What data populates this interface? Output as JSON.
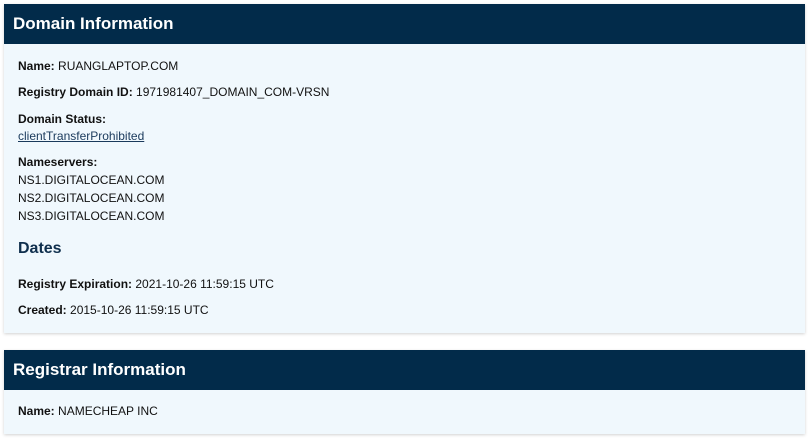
{
  "domain_info": {
    "title": "Domain Information",
    "name_label": "Name:",
    "name_value": "RUANGLAPTOP.COM",
    "registry_id_label": "Registry Domain ID:",
    "registry_id_value": "1971981407_DOMAIN_COM-VRSN",
    "status_label": "Domain Status:",
    "status_value": "clientTransferProhibited",
    "nameservers_label": "Nameservers:",
    "nameservers": [
      "NS1.DIGITALOCEAN.COM",
      "NS2.DIGITALOCEAN.COM",
      "NS3.DIGITALOCEAN.COM"
    ],
    "dates_title": "Dates",
    "expiration_label": "Registry Expiration:",
    "expiration_value": "2021-10-26 11:59:15 UTC",
    "created_label": "Created:",
    "created_value": "2015-10-26 11:59:15 UTC"
  },
  "registrar_info": {
    "title": "Registrar Information",
    "name_label": "Name:",
    "name_value": "NAMECHEAP INC"
  }
}
